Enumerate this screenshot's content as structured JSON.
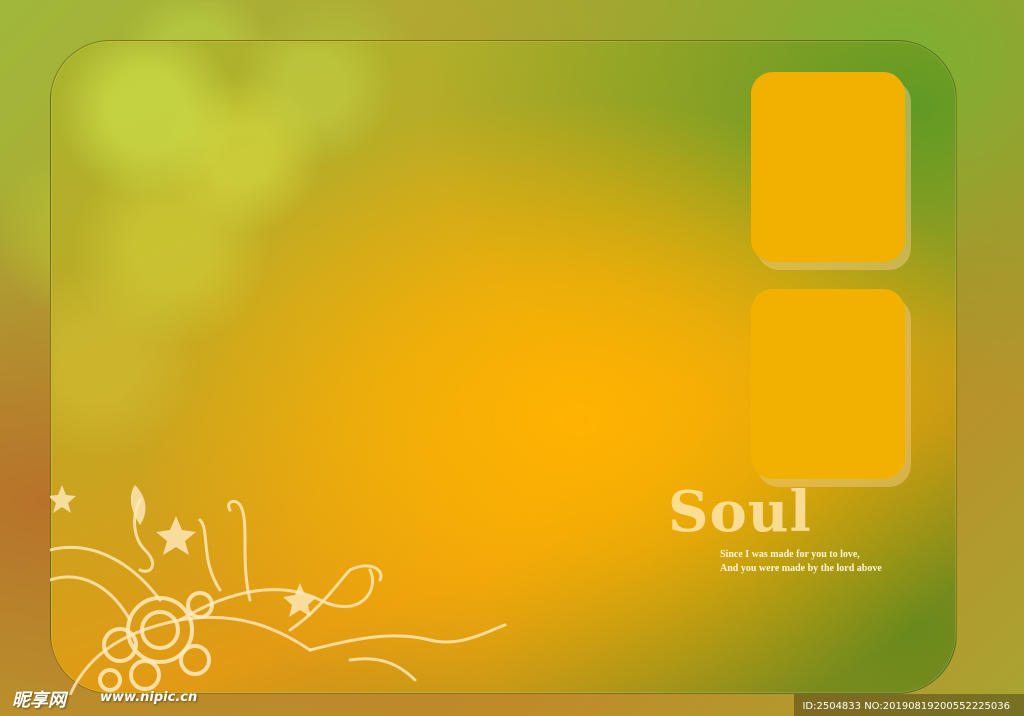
{
  "design": {
    "title": "Soul",
    "lyrics": [
      "Since I was made for you to love,",
      "And you were made by the lord above"
    ],
    "photo_slots": 2
  },
  "watermark": {
    "logo": "昵享网",
    "url": "www.nipic.cn",
    "id_text": "ID:2504833 NO:20190819200552225036"
  },
  "colors": {
    "accent_orange": "#f2b100",
    "frame_green": "#5f9a24",
    "text_light": "#fff6d8"
  }
}
